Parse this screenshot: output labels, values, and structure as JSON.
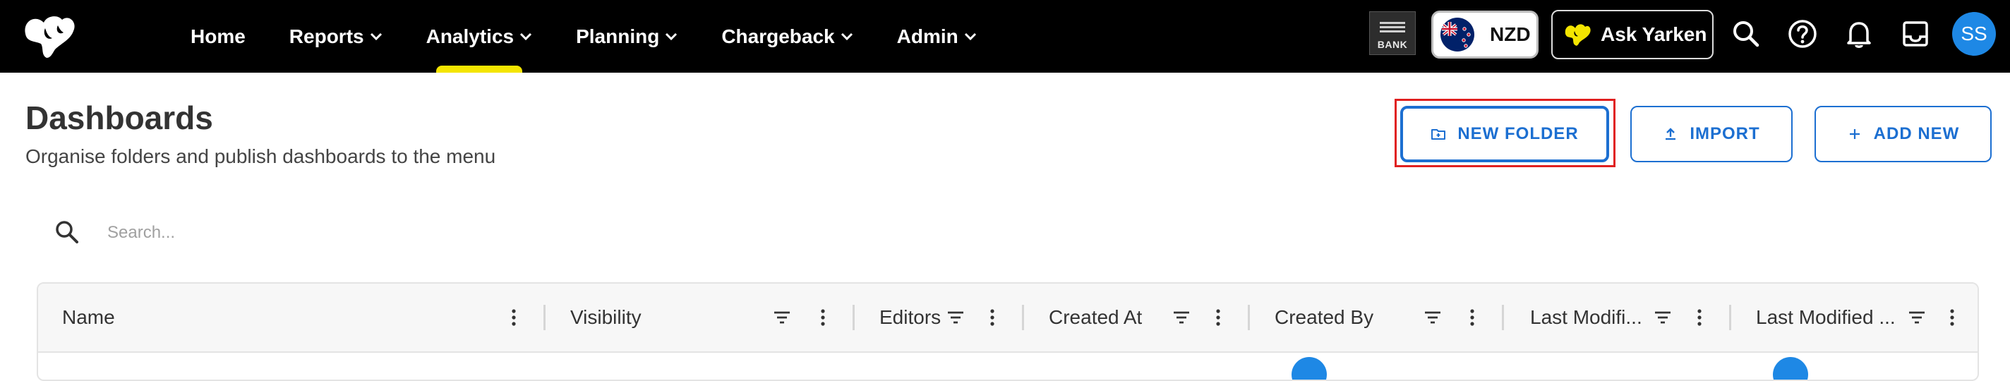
{
  "nav": {
    "items": [
      {
        "label": "Home",
        "dropdown": false
      },
      {
        "label": "Reports",
        "dropdown": true
      },
      {
        "label": "Analytics",
        "dropdown": true,
        "active": true
      },
      {
        "label": "Planning",
        "dropdown": true
      },
      {
        "label": "Chargeback",
        "dropdown": true
      },
      {
        "label": "Admin",
        "dropdown": true
      }
    ],
    "active_indicator_color": "#f4e500"
  },
  "topbar": {
    "bank_label": "BANK",
    "currency": "NZD",
    "ask_label": "Ask Yarken",
    "avatar_initials": "SS",
    "avatar_color": "#1e88e5",
    "icons": [
      "search-icon",
      "help-icon",
      "bell-icon",
      "inbox-icon"
    ]
  },
  "page": {
    "title": "Dashboards",
    "subtitle": "Organise folders and publish dashboards to the menu"
  },
  "actions": {
    "new_folder": "NEW FOLDER",
    "import": "IMPORT",
    "add_new": "ADD NEW",
    "accent_color": "#1c6fd1",
    "highlight_color": "#e02020"
  },
  "search": {
    "placeholder": "Search...",
    "value": ""
  },
  "table": {
    "columns": [
      {
        "label": "Name",
        "filter": false
      },
      {
        "label": "Visibility",
        "filter": true
      },
      {
        "label": "Editors",
        "filter": true
      },
      {
        "label": "Created At",
        "filter": true
      },
      {
        "label": "Created By",
        "filter": true
      },
      {
        "label": "Last Modifi...",
        "filter": true
      },
      {
        "label": "Last Modified ...",
        "filter": true
      }
    ]
  }
}
